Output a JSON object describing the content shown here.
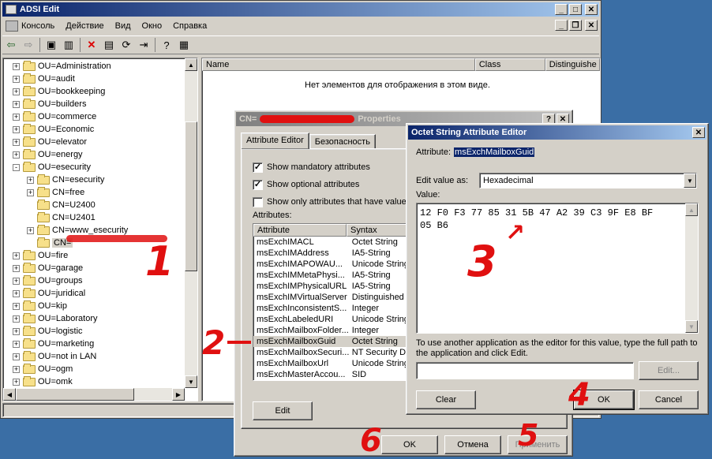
{
  "app": {
    "title": "ADSI Edit",
    "menu": [
      "Консоль",
      "Действие",
      "Вид",
      "Окно",
      "Справка"
    ]
  },
  "tree": {
    "items": [
      {
        "label": "OU=Administration",
        "indent": 0,
        "pm": "+"
      },
      {
        "label": "OU=audit",
        "indent": 0,
        "pm": "+"
      },
      {
        "label": "OU=bookkeeping",
        "indent": 0,
        "pm": "+"
      },
      {
        "label": "OU=builders",
        "indent": 0,
        "pm": "+"
      },
      {
        "label": "OU=commerce",
        "indent": 0,
        "pm": "+"
      },
      {
        "label": "OU=Economic",
        "indent": 0,
        "pm": "+"
      },
      {
        "label": "OU=elevator",
        "indent": 0,
        "pm": "+"
      },
      {
        "label": "OU=energy",
        "indent": 0,
        "pm": "+"
      },
      {
        "label": "OU=esecurity",
        "indent": 0,
        "pm": "-"
      },
      {
        "label": "CN=esecurity",
        "indent": 1,
        "pm": "+"
      },
      {
        "label": "CN=free",
        "indent": 1,
        "pm": "+"
      },
      {
        "label": "CN=U2400",
        "indent": 1,
        "pm": ""
      },
      {
        "label": "CN=U2401",
        "indent": 1,
        "pm": ""
      },
      {
        "label": "CN=www_esecurity",
        "indent": 1,
        "pm": "+"
      },
      {
        "label": "CN=",
        "indent": 1,
        "pm": "",
        "selected": true
      },
      {
        "label": "OU=fire",
        "indent": 0,
        "pm": "+"
      },
      {
        "label": "OU=garage",
        "indent": 0,
        "pm": "+"
      },
      {
        "label": "OU=groups",
        "indent": 0,
        "pm": "+"
      },
      {
        "label": "OU=juridical",
        "indent": 0,
        "pm": "+"
      },
      {
        "label": "OU=kip",
        "indent": 0,
        "pm": "+"
      },
      {
        "label": "OU=Laboratory",
        "indent": 0,
        "pm": "+"
      },
      {
        "label": "OU=logistic",
        "indent": 0,
        "pm": "+"
      },
      {
        "label": "OU=marketing",
        "indent": 0,
        "pm": "+"
      },
      {
        "label": "OU=not in LAN",
        "indent": 0,
        "pm": "+"
      },
      {
        "label": "OU=ogm",
        "indent": 0,
        "pm": "+"
      },
      {
        "label": "OU=omk",
        "indent": 0,
        "pm": "+"
      }
    ]
  },
  "list": {
    "columns": [
      "Name",
      "Class",
      "Distinguishe"
    ],
    "empty": "Нет элементов для отображения в этом виде."
  },
  "props": {
    "title": "CN=",
    "title_suffix": "Properties",
    "tabs": [
      "Attribute Editor",
      "Безопасность"
    ],
    "checks": [
      {
        "label": "Show mandatory attributes",
        "checked": true
      },
      {
        "label": "Show optional attributes",
        "checked": true
      },
      {
        "label": "Show only attributes that have values",
        "checked": false
      }
    ],
    "attributes_label": "Attributes:",
    "columns": [
      "Attribute",
      "Syntax"
    ],
    "rows": [
      {
        "attr": "msExchIMACL",
        "syntax": "Octet String"
      },
      {
        "attr": "msExchIMAddress",
        "syntax": "IA5-String"
      },
      {
        "attr": "msExchIMAPOWAU...",
        "syntax": "Unicode String"
      },
      {
        "attr": "msExchIMMetaPhysi...",
        "syntax": "IA5-String"
      },
      {
        "attr": "msExchIMPhysicalURL",
        "syntax": "IA5-String"
      },
      {
        "attr": "msExchIMVirtualServer",
        "syntax": "Distinguished"
      },
      {
        "attr": "msExchInconsistentS...",
        "syntax": "Integer"
      },
      {
        "attr": "msExchLabeledURI",
        "syntax": "Unicode String"
      },
      {
        "attr": "msExchMailboxFolder...",
        "syntax": "Integer"
      },
      {
        "attr": "msExchMailboxGuid",
        "syntax": "Octet String",
        "selected": true
      },
      {
        "attr": "msExchMailboxSecuri...",
        "syntax": "NT Security D"
      },
      {
        "attr": "msExchMailboxUrl",
        "syntax": "Unicode String"
      },
      {
        "attr": "msExchMasterAccou...",
        "syntax": "SID"
      }
    ],
    "edit_label": "Edit",
    "ok_label": "OK",
    "cancel_label": "Отмена",
    "apply_label": "Применить"
  },
  "octet": {
    "title": "Octet String Attribute Editor",
    "attribute_label": "Attribute:",
    "attribute_value": "msExchMailboxGuid",
    "edit_as_label": "Edit value as:",
    "edit_as_value": "Hexadecimal",
    "value_label": "Value:",
    "value_text": "12 F0 F3 77 85 31 5B 47 A2 39 C3 9F E8 BF\n05 B6",
    "hint": "To use another application as the editor for this value, type the full path to the application and click Edit.",
    "path_value": "",
    "edit_btn": "Edit...",
    "clear_btn": "Clear",
    "ok_btn": "OK",
    "cancel_btn": "Cancel"
  },
  "annotations": {
    "n1": "1",
    "n2": "2",
    "n3": "3",
    "n4": "4",
    "n5": "5",
    "n6": "6",
    "color": "#e01010"
  }
}
